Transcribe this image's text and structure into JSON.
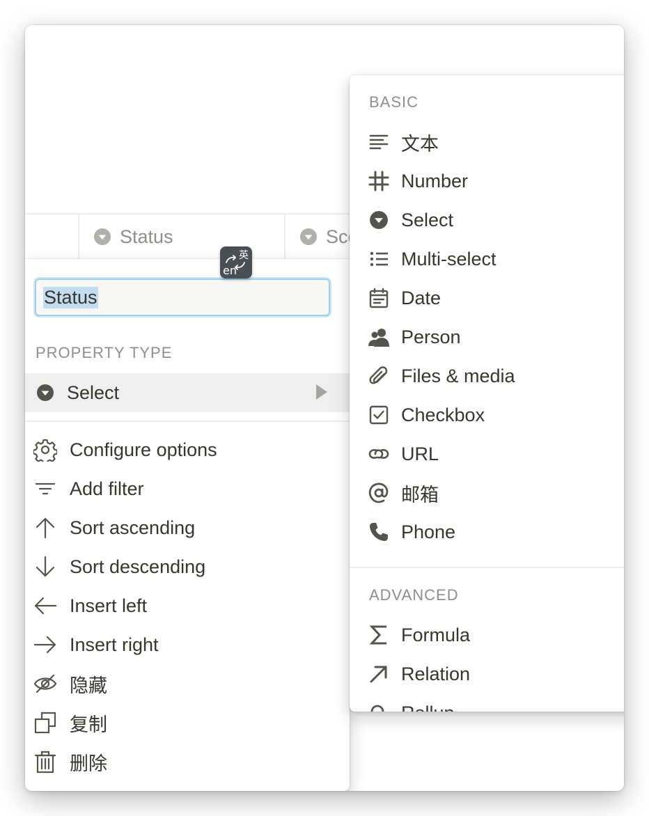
{
  "table_header": {
    "columns": [
      {
        "label": "Status",
        "icon": "select-icon"
      },
      {
        "label": "Sco",
        "icon": "select-icon"
      }
    ]
  },
  "ime_indicator": {
    "zh": "英",
    "en": "en"
  },
  "property_menu": {
    "name_value": "Status",
    "property_type_label": "PROPERTY TYPE",
    "current_type": {
      "label": "Select",
      "icon": "select-icon"
    },
    "items": [
      {
        "label": "Configure options",
        "icon": "gear-icon"
      },
      {
        "label": "Add filter",
        "icon": "filter-icon"
      },
      {
        "label": "Sort ascending",
        "icon": "arrow-up-icon"
      },
      {
        "label": "Sort descending",
        "icon": "arrow-down-icon"
      },
      {
        "label": "Insert left",
        "icon": "arrow-left-icon"
      },
      {
        "label": "Insert right",
        "icon": "arrow-right-icon"
      },
      {
        "label": "隐藏",
        "icon": "eye-off-icon"
      },
      {
        "label": "复制",
        "icon": "duplicate-icon"
      },
      {
        "label": "删除",
        "icon": "trash-icon"
      }
    ]
  },
  "type_menu": {
    "basic_label": "BASIC",
    "basic_items": [
      {
        "label": "文本",
        "icon": "text-icon"
      },
      {
        "label": "Number",
        "icon": "hash-icon"
      },
      {
        "label": "Select",
        "icon": "select-icon"
      },
      {
        "label": "Multi-select",
        "icon": "list-icon"
      },
      {
        "label": "Date",
        "icon": "calendar-icon"
      },
      {
        "label": "Person",
        "icon": "person-icon"
      },
      {
        "label": "Files & media",
        "icon": "paperclip-icon"
      },
      {
        "label": "Checkbox",
        "icon": "checkbox-icon"
      },
      {
        "label": "URL",
        "icon": "link-icon"
      },
      {
        "label": "邮箱",
        "icon": "at-icon"
      },
      {
        "label": "Phone",
        "icon": "phone-icon"
      }
    ],
    "advanced_label": "ADVANCED",
    "advanced_items": [
      {
        "label": "Formula",
        "icon": "sigma-icon"
      },
      {
        "label": "Relation",
        "icon": "arrow-up-right-icon"
      },
      {
        "label": "Rollup",
        "icon": "search-icon"
      }
    ]
  },
  "colors": {
    "icon_gray": "#55534e",
    "header_gray": "#8f8e8a",
    "input_focus": "#9ccfea",
    "selection": "#c3dcf0"
  }
}
